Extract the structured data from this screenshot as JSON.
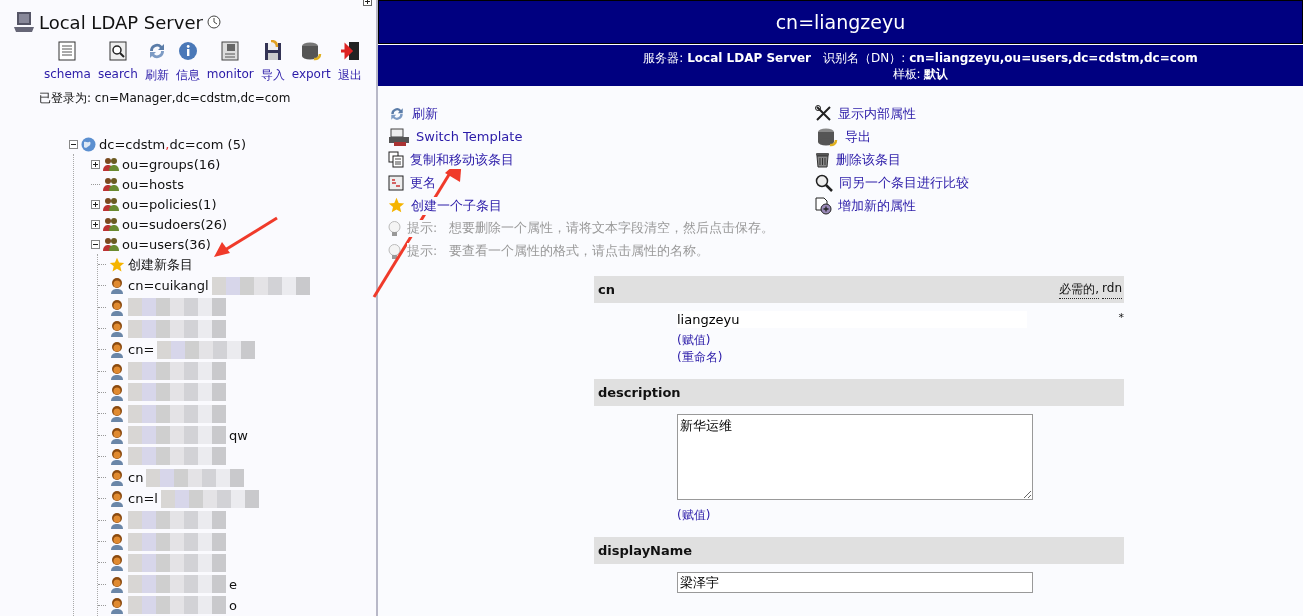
{
  "sidebar": {
    "server_title": "Local LDAP Server",
    "toolbar": [
      {
        "kind": "schema",
        "label": "schema"
      },
      {
        "kind": "search",
        "label": "search"
      },
      {
        "kind": "refresh",
        "label": "刷新"
      },
      {
        "kind": "info",
        "label": "信息"
      },
      {
        "kind": "monitor",
        "label": "monitor"
      },
      {
        "kind": "import",
        "label": "导入"
      },
      {
        "kind": "export",
        "label": "export"
      },
      {
        "kind": "logout",
        "label": "退出"
      }
    ],
    "logged_in": "已登录为: cn=Manager,dc=cdstm,dc=com",
    "tree": {
      "kind": "root",
      "rdn_parts": [
        "dc=cdstm",
        "dc=com"
      ],
      "separator": ",",
      "count": "(5)",
      "expanded": true,
      "children": [
        {
          "kind": "ou",
          "label": "ou=groups",
          "count": "(16)",
          "has_children": true,
          "expanded": false
        },
        {
          "kind": "ou",
          "label": "ou=hosts",
          "has_children": false
        },
        {
          "kind": "ou",
          "label": "ou=policies",
          "count": "(1)",
          "has_children": true,
          "expanded": false
        },
        {
          "kind": "ou",
          "label": "ou=sudoers",
          "count": "(26)",
          "has_children": true,
          "expanded": false
        },
        {
          "kind": "ou",
          "label": "ou=users",
          "count": "(36)",
          "has_children": true,
          "expanded": true,
          "children": [
            {
              "kind": "create",
              "label": "创建新条目"
            },
            {
              "kind": "user",
              "prefix": "cn=cuikangl",
              "blurred": true
            },
            {
              "kind": "user",
              "blurred": true
            },
            {
              "kind": "user",
              "blurred": true
            },
            {
              "kind": "user",
              "prefix": "cn=",
              "blurred": true
            },
            {
              "kind": "user",
              "blurred": true
            },
            {
              "kind": "user",
              "blurred": true
            },
            {
              "kind": "user",
              "blurred": true
            },
            {
              "kind": "user",
              "suffix": "qw",
              "blurred": true
            },
            {
              "kind": "user",
              "blurred": true
            },
            {
              "kind": "user",
              "prefix": "cn",
              "blurred": true
            },
            {
              "kind": "user",
              "prefix": "cn=l",
              "blurred": true
            },
            {
              "kind": "user",
              "blurred": true
            },
            {
              "kind": "user",
              "blurred": true
            },
            {
              "kind": "user",
              "blurred": true
            },
            {
              "kind": "user",
              "suffix": "e",
              "blurred": true
            },
            {
              "kind": "user",
              "suffix": "o",
              "blurred": true
            }
          ]
        }
      ]
    }
  },
  "entry": {
    "title": "cn=liangzeyu",
    "server_label": "服务器:",
    "server": "Local LDAP Server",
    "dn_label": "识别名（DN）:",
    "dn": "cn=liangzeyu,ou=users,dc=cdstm,dc=com",
    "template_label": "样板:",
    "template": "默认",
    "actions_left": [
      {
        "kind": "refresh",
        "label": "刷新"
      },
      {
        "kind": "template",
        "label": "Switch Template"
      },
      {
        "kind": "copy",
        "label": "复制和移动该条目"
      },
      {
        "kind": "rename",
        "label": "更名"
      },
      {
        "kind": "star",
        "label": "创建一个子条目"
      }
    ],
    "hints": [
      {
        "label": "提示:",
        "text": "想要删除一个属性，请将文本字段清空，然后点击保存。"
      },
      {
        "label": "提示:",
        "text": "要查看一个属性的格式，请点击属性的名称。"
      }
    ],
    "actions_right": [
      {
        "kind": "tools",
        "label": "显示内部属性"
      },
      {
        "kind": "export",
        "label": "导出"
      },
      {
        "kind": "trash",
        "label": "删除该条目"
      },
      {
        "kind": "compare",
        "label": "同另一个条目进行比较"
      },
      {
        "kind": "add",
        "label": "增加新的属性"
      }
    ],
    "attributes": [
      {
        "name": "cn",
        "flags": [
          "必需的,",
          "rdn"
        ],
        "kind": "plain",
        "value": "liangzeyu",
        "marker": "*",
        "links": [
          "(赋值)",
          "(重命名)"
        ]
      },
      {
        "name": "description",
        "kind": "textarea",
        "value": "新华运维",
        "links": [
          "(赋值)"
        ]
      },
      {
        "name": "displayName",
        "kind": "text",
        "value": "梁泽宇"
      }
    ]
  },
  "annotations": [
    {
      "kind": "arrow"
    },
    {
      "kind": "arrow"
    }
  ]
}
